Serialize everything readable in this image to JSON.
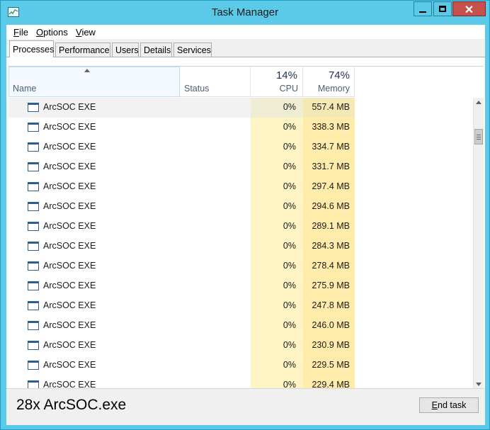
{
  "window": {
    "title": "Task Manager",
    "accent": "#5bc9e8",
    "close_color": "#c7504c",
    "controls": {
      "minimize": "minimize-icon",
      "maximize": "maximize-icon",
      "close": "✕"
    }
  },
  "menu": [
    {
      "key": "F",
      "rest": "ile"
    },
    {
      "key": "O",
      "rest": "ptions"
    },
    {
      "key": "V",
      "rest": "iew"
    }
  ],
  "tabs": [
    "Processes",
    "Performance",
    "Users",
    "Details",
    "Services"
  ],
  "active_tab": "Processes",
  "columns": {
    "name": {
      "label": "Name",
      "sorted": "ascending"
    },
    "status": {
      "label": "Status"
    },
    "cpu": {
      "label": "CPU",
      "total": "14%"
    },
    "memory": {
      "label": "Memory",
      "total": "74%"
    }
  },
  "processes": [
    {
      "name": "ArcSOC EXE",
      "status": "",
      "cpu": "0%",
      "memory": "557.4 MB"
    },
    {
      "name": "ArcSOC EXE",
      "status": "",
      "cpu": "0%",
      "memory": "338.3 MB"
    },
    {
      "name": "ArcSOC EXE",
      "status": "",
      "cpu": "0%",
      "memory": "334.7 MB"
    },
    {
      "name": "ArcSOC EXE",
      "status": "",
      "cpu": "0%",
      "memory": "331.7 MB"
    },
    {
      "name": "ArcSOC EXE",
      "status": "",
      "cpu": "0%",
      "memory": "297.4 MB"
    },
    {
      "name": "ArcSOC EXE",
      "status": "",
      "cpu": "0%",
      "memory": "294.6 MB"
    },
    {
      "name": "ArcSOC EXE",
      "status": "",
      "cpu": "0%",
      "memory": "289.1 MB"
    },
    {
      "name": "ArcSOC EXE",
      "status": "",
      "cpu": "0%",
      "memory": "284.3 MB"
    },
    {
      "name": "ArcSOC EXE",
      "status": "",
      "cpu": "0%",
      "memory": "278.4 MB"
    },
    {
      "name": "ArcSOC EXE",
      "status": "",
      "cpu": "0%",
      "memory": "275.9 MB"
    },
    {
      "name": "ArcSOC EXE",
      "status": "",
      "cpu": "0%",
      "memory": "247.8 MB"
    },
    {
      "name": "ArcSOC EXE",
      "status": "",
      "cpu": "0%",
      "memory": "246.0 MB"
    },
    {
      "name": "ArcSOC EXE",
      "status": "",
      "cpu": "0%",
      "memory": "230.9 MB"
    },
    {
      "name": "ArcSOC EXE",
      "status": "",
      "cpu": "0%",
      "memory": "229.5 MB"
    },
    {
      "name": "ArcSOC EXE",
      "status": "",
      "cpu": "0%",
      "memory": "229.4 MB"
    }
  ],
  "selected_row": 0,
  "footer": {
    "caption": "28x ArcSOC.exe",
    "end_task": {
      "key": "E",
      "rest": "nd task"
    }
  }
}
